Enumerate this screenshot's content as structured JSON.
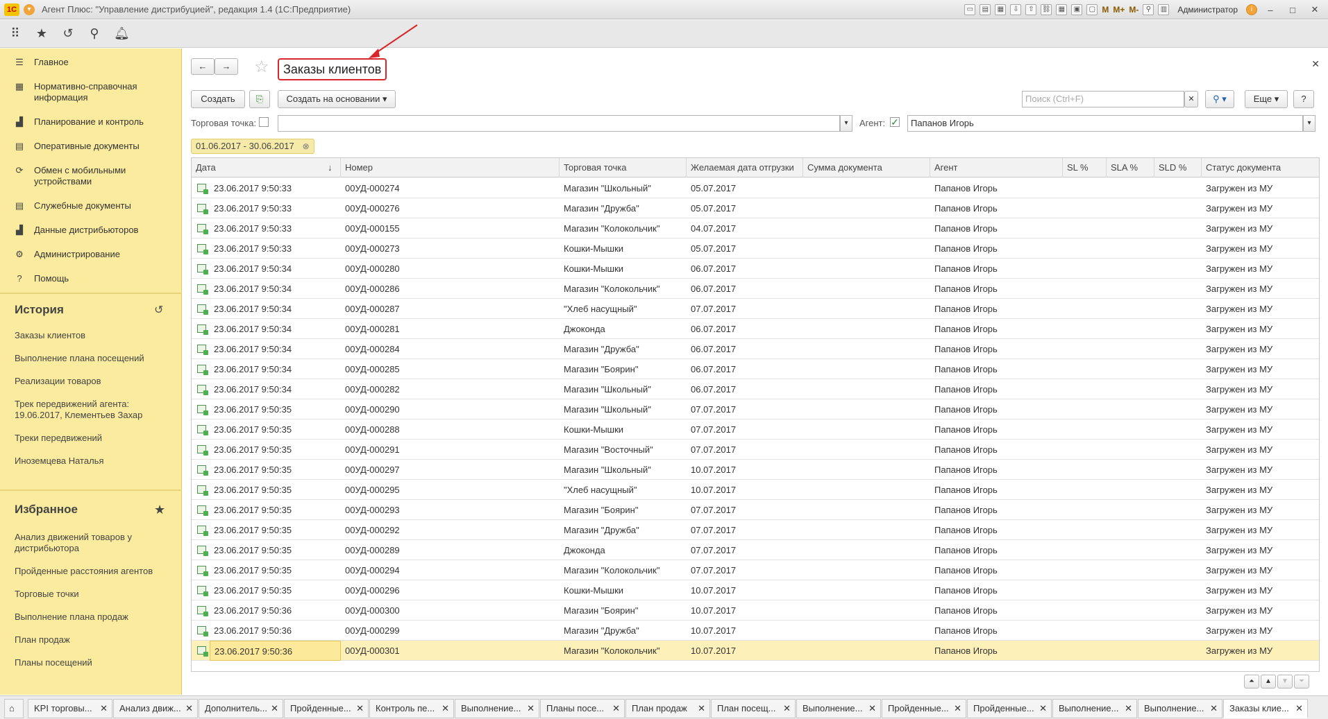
{
  "app": {
    "title": "Агент Плюс: \"Управление дистрибуцией\", редакция 1.4  (1С:Предприятие)",
    "user": "Администратор"
  },
  "sidebar": {
    "nav": [
      {
        "label": "Главное",
        "icon": "menu-icon"
      },
      {
        "label": "Нормативно-справочная информация",
        "icon": "grid-icon"
      },
      {
        "label": "Планирование и контроль",
        "icon": "chart-icon"
      },
      {
        "label": "Оперативные документы",
        "icon": "document-icon"
      },
      {
        "label": "Обмен с мобильными устройствами",
        "icon": "sync-icon"
      },
      {
        "label": "Служебные документы",
        "icon": "document-icon"
      },
      {
        "label": "Данные дистрибьюторов",
        "icon": "chart-icon"
      },
      {
        "label": "Администрирование",
        "icon": "gear-icon"
      },
      {
        "label": "Помощь",
        "icon": "question-icon"
      }
    ],
    "history_title": "История",
    "history": [
      "Заказы клиентов",
      "Выполнение плана посещений",
      "Реализации товаров",
      "Трек передвижений агента: 19.06.2017, Клементьев Захар",
      "Треки передвижений",
      "Иноземцева Наталья"
    ],
    "favorites_title": "Избранное",
    "favorites": [
      "Анализ движений товаров у дистрибьютора",
      "Пройденные расстояния агентов",
      "Торговые точки",
      "Выполнение плана продаж",
      "План продаж",
      "Планы посещений"
    ]
  },
  "page": {
    "title": "Заказы клиентов",
    "create_label": "Создать",
    "create_based_label": "Создать на основании",
    "search_placeholder": "Поиск (Ctrl+F)",
    "more_label": "Еще",
    "help_label": "?",
    "outlet_label": "Торговая точка:",
    "agent_label": "Агент:",
    "agent_value": "Папанов Игорь",
    "period": "01.06.2017 - 30.06.2017"
  },
  "table": {
    "columns": [
      "Дата",
      "Номер",
      "Торговая точка",
      "Желаемая дата отгрузки",
      "Сумма документа",
      "Агент",
      "SL %",
      "SLA %",
      "SLD %",
      "Статус документа"
    ],
    "rows": [
      [
        "23.06.2017 9:50:33",
        "00УД-000274",
        "Магазин \"Школьный\"",
        "05.07.2017",
        "",
        "Папанов Игорь",
        "",
        "",
        "",
        "Загружен из МУ"
      ],
      [
        "23.06.2017 9:50:33",
        "00УД-000276",
        "Магазин \"Дружба\"",
        "05.07.2017",
        "",
        "Папанов Игорь",
        "",
        "",
        "",
        "Загружен из МУ"
      ],
      [
        "23.06.2017 9:50:33",
        "00УД-000155",
        "Магазин \"Колокольчик\"",
        "04.07.2017",
        "",
        "Папанов Игорь",
        "",
        "",
        "",
        "Загружен из МУ"
      ],
      [
        "23.06.2017 9:50:33",
        "00УД-000273",
        "Кошки-Мышки",
        "05.07.2017",
        "",
        "Папанов Игорь",
        "",
        "",
        "",
        "Загружен из МУ"
      ],
      [
        "23.06.2017 9:50:34",
        "00УД-000280",
        "Кошки-Мышки",
        "06.07.2017",
        "",
        "Папанов Игорь",
        "",
        "",
        "",
        "Загружен из МУ"
      ],
      [
        "23.06.2017 9:50:34",
        "00УД-000286",
        "Магазин \"Колокольчик\"",
        "06.07.2017",
        "",
        "Папанов Игорь",
        "",
        "",
        "",
        "Загружен из МУ"
      ],
      [
        "23.06.2017 9:50:34",
        "00УД-000287",
        "\"Хлеб насущный\"",
        "07.07.2017",
        "",
        "Папанов Игорь",
        "",
        "",
        "",
        "Загружен из МУ"
      ],
      [
        "23.06.2017 9:50:34",
        "00УД-000281",
        "Джоконда",
        "06.07.2017",
        "",
        "Папанов Игорь",
        "",
        "",
        "",
        "Загружен из МУ"
      ],
      [
        "23.06.2017 9:50:34",
        "00УД-000284",
        "Магазин \"Дружба\"",
        "06.07.2017",
        "",
        "Папанов Игорь",
        "",
        "",
        "",
        "Загружен из МУ"
      ],
      [
        "23.06.2017 9:50:34",
        "00УД-000285",
        "Магазин \"Боярин\"",
        "06.07.2017",
        "",
        "Папанов Игорь",
        "",
        "",
        "",
        "Загружен из МУ"
      ],
      [
        "23.06.2017 9:50:34",
        "00УД-000282",
        "Магазин \"Школьный\"",
        "06.07.2017",
        "",
        "Папанов Игорь",
        "",
        "",
        "",
        "Загружен из МУ"
      ],
      [
        "23.06.2017 9:50:35",
        "00УД-000290",
        "Магазин \"Школьный\"",
        "07.07.2017",
        "",
        "Папанов Игорь",
        "",
        "",
        "",
        "Загружен из МУ"
      ],
      [
        "23.06.2017 9:50:35",
        "00УД-000288",
        "Кошки-Мышки",
        "07.07.2017",
        "",
        "Папанов Игорь",
        "",
        "",
        "",
        "Загружен из МУ"
      ],
      [
        "23.06.2017 9:50:35",
        "00УД-000291",
        "Магазин \"Восточный\"",
        "07.07.2017",
        "",
        "Папанов Игорь",
        "",
        "",
        "",
        "Загружен из МУ"
      ],
      [
        "23.06.2017 9:50:35",
        "00УД-000297",
        "Магазин \"Школьный\"",
        "10.07.2017",
        "",
        "Папанов Игорь",
        "",
        "",
        "",
        "Загружен из МУ"
      ],
      [
        "23.06.2017 9:50:35",
        "00УД-000295",
        "\"Хлеб насущный\"",
        "10.07.2017",
        "",
        "Папанов Игорь",
        "",
        "",
        "",
        "Загружен из МУ"
      ],
      [
        "23.06.2017 9:50:35",
        "00УД-000293",
        "Магазин \"Боярин\"",
        "07.07.2017",
        "",
        "Папанов Игорь",
        "",
        "",
        "",
        "Загружен из МУ"
      ],
      [
        "23.06.2017 9:50:35",
        "00УД-000292",
        "Магазин \"Дружба\"",
        "07.07.2017",
        "",
        "Папанов Игорь",
        "",
        "",
        "",
        "Загружен из МУ"
      ],
      [
        "23.06.2017 9:50:35",
        "00УД-000289",
        "Джоконда",
        "07.07.2017",
        "",
        "Папанов Игорь",
        "",
        "",
        "",
        "Загружен из МУ"
      ],
      [
        "23.06.2017 9:50:35",
        "00УД-000294",
        "Магазин \"Колокольчик\"",
        "07.07.2017",
        "",
        "Папанов Игорь",
        "",
        "",
        "",
        "Загружен из МУ"
      ],
      [
        "23.06.2017 9:50:35",
        "00УД-000296",
        "Кошки-Мышки",
        "10.07.2017",
        "",
        "Папанов Игорь",
        "",
        "",
        "",
        "Загружен из МУ"
      ],
      [
        "23.06.2017 9:50:36",
        "00УД-000300",
        "Магазин \"Боярин\"",
        "10.07.2017",
        "",
        "Папанов Игорь",
        "",
        "",
        "",
        "Загружен из МУ"
      ],
      [
        "23.06.2017 9:50:36",
        "00УД-000299",
        "Магазин \"Дружба\"",
        "10.07.2017",
        "",
        "Папанов Игорь",
        "",
        "",
        "",
        "Загружен из МУ"
      ],
      [
        "23.06.2017 9:50:36",
        "00УД-000301",
        "Магазин \"Колокольчик\"",
        "10.07.2017",
        "",
        "Папанов Игорь",
        "",
        "",
        "",
        "Загружен из МУ"
      ]
    ]
  },
  "tabs": [
    "KPI торговы...",
    "Анализ движ...",
    "Дополнитель...",
    "Пройденные...",
    "Контроль пе...",
    "Выполнение...",
    "Планы посе...",
    "План продаж",
    "План посещ...",
    "Выполнение...",
    "Пройденные...",
    "Пройденные...",
    "Выполнение...",
    "Выполнение...",
    "Заказы клие..."
  ]
}
